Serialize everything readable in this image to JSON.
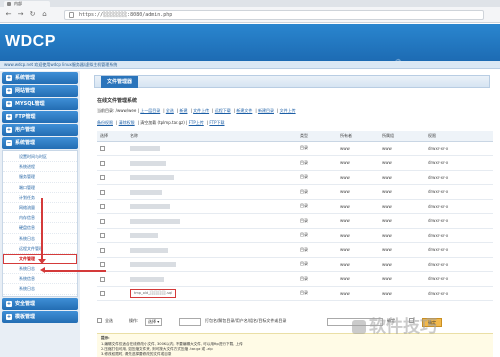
{
  "browser": {
    "tab_title": "内部",
    "url": "https://░░░░░░░░:8080/admin.php"
  },
  "header": {
    "logo": "WDCP"
  },
  "statusbar": {
    "text": "www.wdcp.net 欢迎使用wdcp linux服务器/虚拟主机管理系统"
  },
  "sidebar": {
    "groups": [
      {
        "label": "系统管理"
      },
      {
        "label": "网站管理"
      },
      {
        "label": "MYSQL管理"
      },
      {
        "label": "FTP管理"
      },
      {
        "label": "用户管理"
      },
      {
        "label": "系统管理"
      }
    ],
    "subitems": [
      "设置时间与时区",
      "系统进程",
      "服务管理",
      "端口管理",
      "计划任务",
      "网络流量",
      "内存信息",
      "硬盘信息",
      "系统日志",
      "远程文件管理",
      "文件管理",
      "系统日志",
      "系统信息",
      "系统日志"
    ],
    "bottom_groups": [
      {
        "label": "安全管理"
      },
      {
        "label": "模板管理"
      }
    ]
  },
  "main": {
    "panel_tab": "文件管理器",
    "section_title": "在线文件管理系统",
    "toolbar1": {
      "path_label": "当前目录: /www/wee",
      "links": [
        "上一层目录",
        "全选",
        "新建",
        "文件上传",
        "远程下载",
        "新建文件",
        "新建目录",
        "文件上传"
      ]
    },
    "toolbar2": {
      "links": [
        "备份权限",
        "清除权限"
      ],
      "text": "清空加载 (tplmp.tar.gz)",
      "links2": [
        "FTP上传",
        "FTP下载"
      ]
    },
    "table": {
      "headers": [
        "选择",
        "名称",
        "类型",
        "所有者",
        "所属组",
        "权限"
      ],
      "rows": [
        {
          "type": "目录",
          "owner": "www",
          "group": "www",
          "perm": "drwxr-xr-x"
        },
        {
          "type": "目录",
          "owner": "www",
          "group": "www",
          "perm": "drwxr-xr-x"
        },
        {
          "type": "目录",
          "owner": "www",
          "group": "www",
          "perm": "drwxr-xr-x"
        },
        {
          "type": "目录",
          "owner": "www",
          "group": "www",
          "perm": "drwxr-xr-x"
        },
        {
          "type": "目录",
          "owner": "www",
          "group": "www",
          "perm": "drwxr-xr-x"
        },
        {
          "type": "目录",
          "owner": "www",
          "group": "www",
          "perm": "drwxr-xr-x"
        },
        {
          "type": "目录",
          "owner": "www",
          "group": "www",
          "perm": "drwxr-xr-x"
        },
        {
          "type": "目录",
          "owner": "www",
          "group": "www",
          "perm": "drwxr-xr-x"
        },
        {
          "type": "目录",
          "owner": "www",
          "group": "www",
          "perm": "drwxr-xr-x"
        },
        {
          "type": "目录",
          "owner": "www",
          "group": "www",
          "perm": "drwxr-xr-x"
        },
        {
          "type": "目录",
          "owner": "www",
          "group": "www",
          "perm": "drwxr-xr-x"
        }
      ],
      "edit_value": "tmp_old_░░░░░░.sql"
    },
    "actionbar": {
      "select_all_label": "全选",
      "op_label": "操作:",
      "op_selected": "选择",
      "hint": "打包名/解包目录/用户名/组名/目标文件或目录",
      "confirm_label": "确定",
      "ok_button": "确定"
    },
    "notes": {
      "title": "提示:",
      "lines": [
        "1.编辑文件仅适合在线修改小文件, 300K以内, 不要编辑大文件, 可以用ftp进行下载, 上传",
        "2.压缩打包可用, 如压缩文件夹, 则可按大文件方式压缩 .tar.gz 或 .zip",
        "3.修改权限时, 请先选择要修改的文件或目录"
      ]
    }
  },
  "watermarks": {
    "php": "php.cn",
    "brand": "软件技巧"
  },
  "colors": {
    "header": "#1d6bb3",
    "sidebar_head": "#236db3",
    "highlight": "#d43a3a",
    "ok_button": "#f2b84b"
  }
}
